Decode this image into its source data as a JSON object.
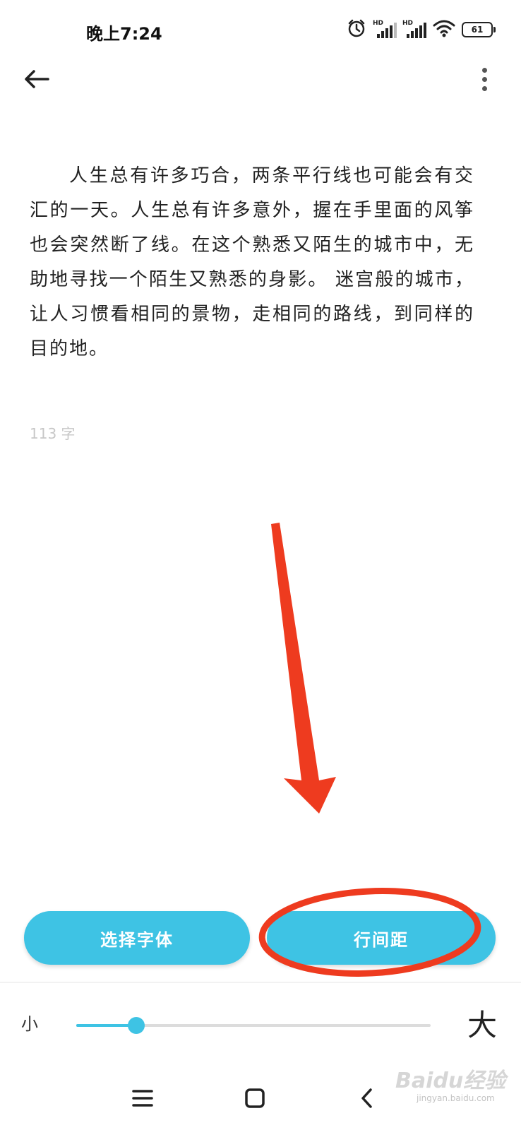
{
  "status_bar": {
    "time": "晚上7:24",
    "battery": "61",
    "hd1": "HD",
    "hd2": "HD",
    "icons": [
      "alarm-icon",
      "signal-icon",
      "signal-icon",
      "wifi-icon",
      "battery-icon"
    ]
  },
  "toolbar": {
    "back_icon": "back-arrow-icon",
    "more_icon": "more-vertical-icon"
  },
  "content": {
    "text": "人生总有许多巧合，两条平行线也可能会有交汇的一天。人生总有许多意外，握在手里面的风筝也会突然断了线。在这个熟悉又陌生的城市中，无助地寻找一个陌生又熟悉的身影。 迷宫般的城市，让人习惯看相同的景物，走相同的路线，到同样的目的地。",
    "word_count": "113 字"
  },
  "buttons": {
    "select_font": "选择字体",
    "line_spacing": "行间距"
  },
  "font_size": {
    "small_label": "小",
    "large_label": "大",
    "slider_value": 0.17
  },
  "nav_bar": {
    "icons": [
      "menu-icon",
      "home-icon",
      "back-icon"
    ]
  },
  "watermark": {
    "main": "Baidu经验",
    "sub": "jingyan.baidu.com"
  },
  "colors": {
    "accent": "#3ec3e4",
    "annotation": "#ee3b1f"
  }
}
